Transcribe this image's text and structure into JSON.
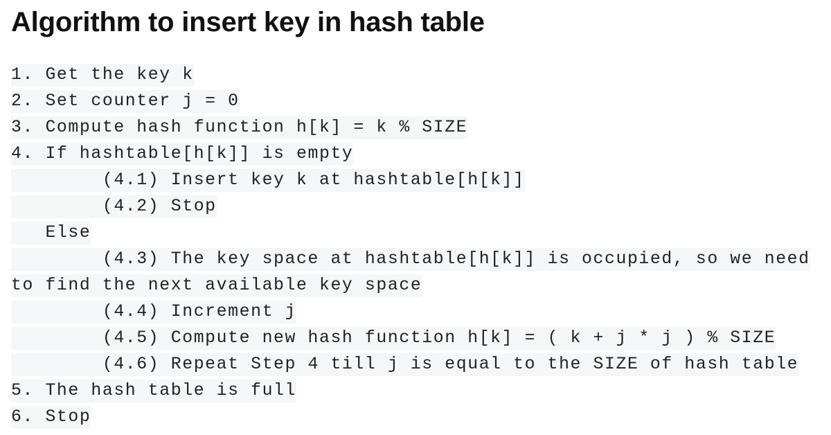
{
  "title": "Algorithm to insert key in hash table",
  "lines": [
    "1. Get the key k",
    "2. Set counter j = 0",
    "3. Compute hash function h[k] = k % SIZE",
    "4. If hashtable[h[k]] is empty",
    "        (4.1) Insert key k at hashtable[h[k]]",
    "        (4.2) Stop",
    "   Else",
    "        (4.3) The key space at hashtable[h[k]] is occupied, so we need",
    "to find the next available key space",
    "        (4.4) Increment j",
    "        (4.5) Compute new hash function h[k] = ( k + j * j ) % SIZE",
    "        (4.6) Repeat Step 4 till j is equal to the SIZE of hash table",
    "5. The hash table is full",
    "6. Stop"
  ]
}
